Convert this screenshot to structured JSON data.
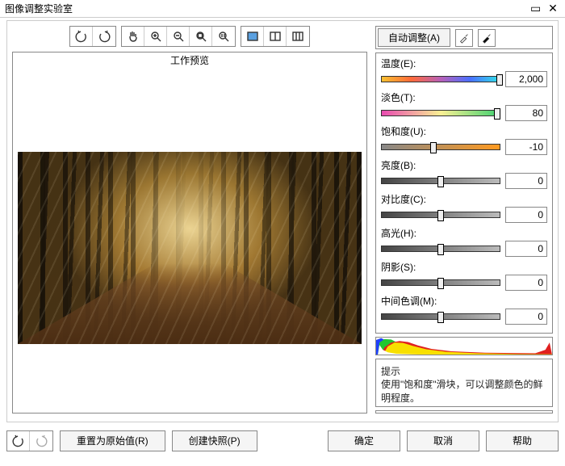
{
  "window": {
    "title": "图像调整实验室"
  },
  "toolbar_icons": [
    "rotate-left-icon",
    "rotate-right-icon",
    "pan-icon",
    "zoom-in-icon",
    "zoom-out-icon",
    "zoom-fit-icon",
    "zoom-100-icon",
    "single-view-icon",
    "split-view-icon",
    "thumbnails-icon"
  ],
  "preview_title": "工作预览",
  "auto_adjust_label": "自动调整(A)",
  "eyedropper_icons": [
    "eyedropper-white-icon",
    "eyedropper-black-icon"
  ],
  "sliders": [
    {
      "key": "temperature",
      "label": "温度(E):",
      "value": "2,000",
      "type": "temp",
      "pos": 100
    },
    {
      "key": "tint",
      "label": "淡色(T):",
      "value": "80",
      "type": "tint",
      "pos": 98
    },
    {
      "key": "saturation",
      "label": "饱和度(U):",
      "value": "-10",
      "type": "sat",
      "pos": 44
    },
    {
      "key": "brightness",
      "label": "亮度(B):",
      "value": "0",
      "type": "gray",
      "pos": 50
    },
    {
      "key": "contrast",
      "label": "对比度(C):",
      "value": "0",
      "type": "gray",
      "pos": 50
    },
    {
      "key": "highlights",
      "label": "高光(H):",
      "value": "0",
      "type": "gray",
      "pos": 50
    },
    {
      "key": "shadows",
      "label": "阴影(S):",
      "value": "0",
      "type": "gray",
      "pos": 50
    },
    {
      "key": "midtones",
      "label": "中间色调(M):",
      "value": "0",
      "type": "gray",
      "pos": 50
    }
  ],
  "hint": {
    "title": "提示",
    "text": "使用\"饱和度\"滑块，可以调整颜色的鲜明程度。"
  },
  "footer": {
    "reset": "重置为原始值(R)",
    "snapshot": "创建快照(P)",
    "ok": "确定",
    "cancel": "取消",
    "help": "帮助"
  }
}
